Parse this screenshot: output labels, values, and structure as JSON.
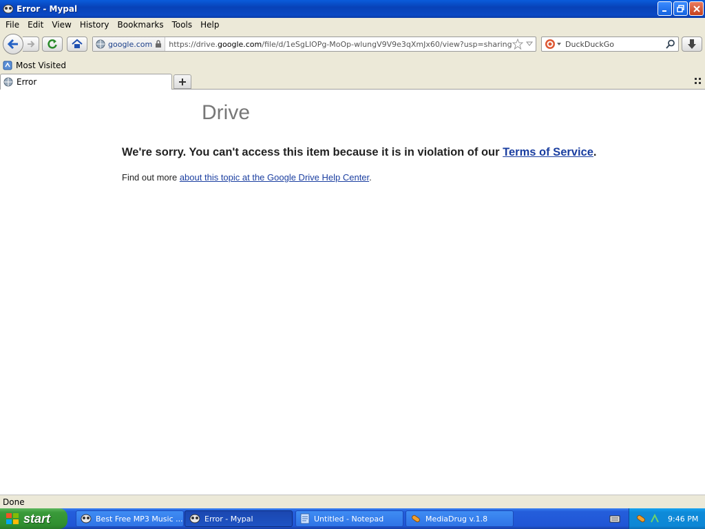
{
  "window": {
    "title": "Error - Mypal"
  },
  "menu": [
    "File",
    "Edit",
    "View",
    "History",
    "Bookmarks",
    "Tools",
    "Help"
  ],
  "navbar": {
    "site_host": "google.com",
    "url_prefix": "https://drive.",
    "url_domain": "google.com",
    "url_path": "/file/d/1eSgLlOPg-MoOp-wlungV9V9e3qXmJx60/view?usp=sharing",
    "search_placeholder": "DuckDuckGo"
  },
  "bookmarks": {
    "most_visited": "Most Visited"
  },
  "tabs": [
    {
      "label": "Error"
    }
  ],
  "page": {
    "logo": "Drive",
    "sorry_text": "We're sorry. You can't access this item because it is in violation of our ",
    "tos_link": "Terms of Service",
    "sorry_end": ".",
    "findout_text": "Find out more ",
    "help_link": "about this topic at the Google Drive Help Center",
    "findout_end": "."
  },
  "status": "Done",
  "taskbar": {
    "start_label": "start",
    "tasks": [
      {
        "label": "Best Free MP3 Music ..."
      },
      {
        "label": "Error - Mypal"
      },
      {
        "label": "Untitled - Notepad"
      },
      {
        "label": "MediaDrug v.1.8"
      }
    ],
    "clock": "9:46 PM"
  },
  "colors": {
    "link": "#1a3ea0",
    "titlebar": "#0a48c4",
    "taskbar": "#245edb",
    "start": "#3a9a3a"
  }
}
